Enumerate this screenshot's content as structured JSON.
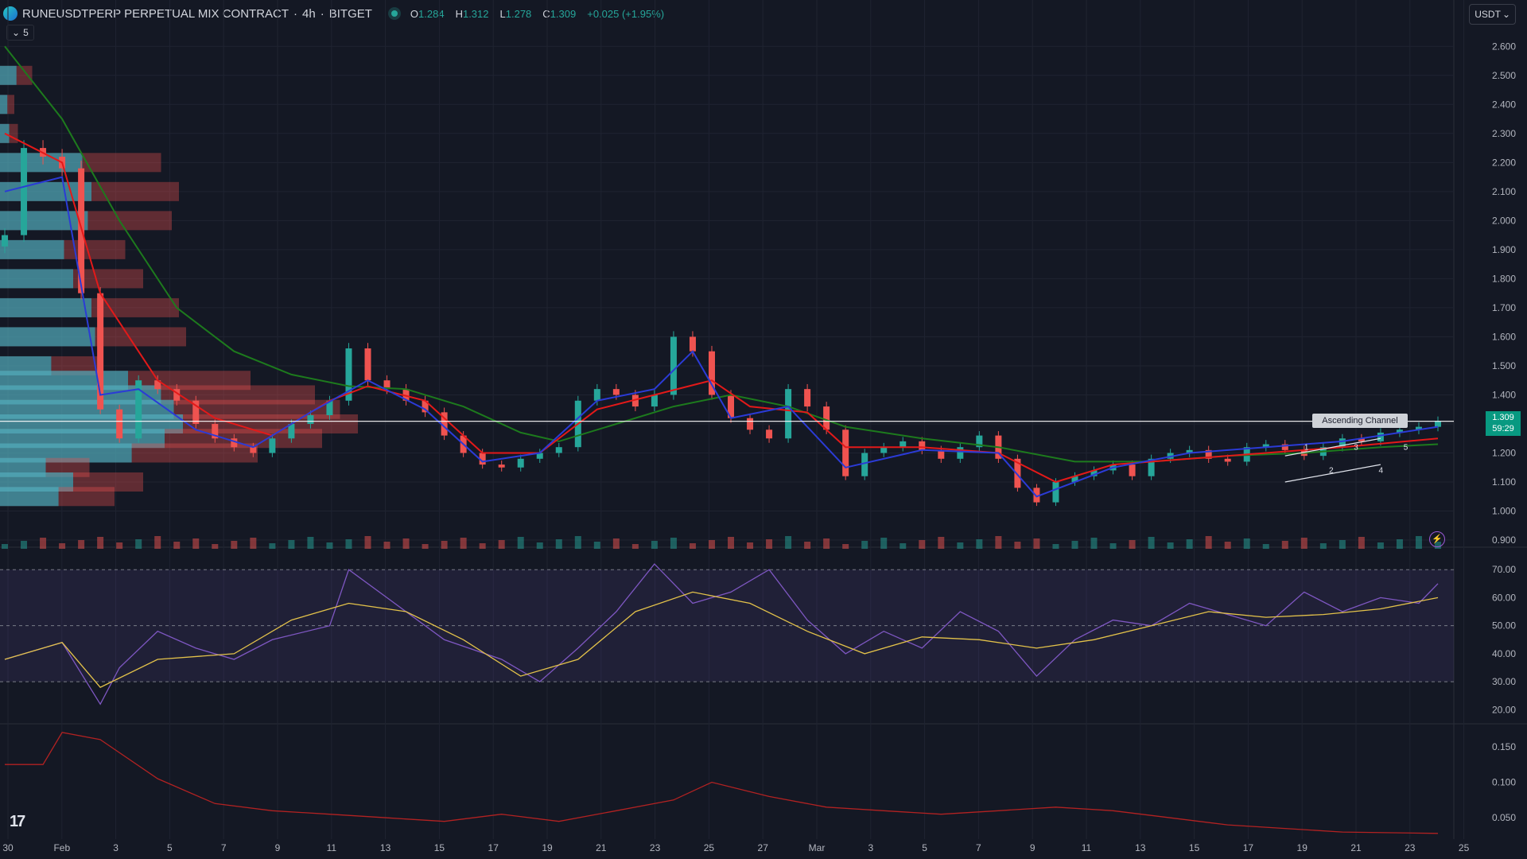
{
  "header": {
    "symbol": "RUNEUSDTPERP PERPETUAL MIX CONTRACT",
    "interval": "4h",
    "exchange": "BITGET",
    "sep": "·",
    "o_label": "O",
    "o": "1.284",
    "h_label": "H",
    "h": "1.312",
    "l_label": "L",
    "l": "1.278",
    "c_label": "C",
    "c": "1.309",
    "change": "+0.025 (+1.95%)",
    "indicator_count": "5",
    "currency": "USDT"
  },
  "current_price": {
    "value": "1.309",
    "countdown": "59:29"
  },
  "annotation": {
    "pattern_label": "Ascending Channel",
    "wave_labels": [
      "1",
      "2",
      "3",
      "4",
      "5"
    ]
  },
  "colors": {
    "bg": "#141824",
    "grid": "#1f2331",
    "up": "#26a69a",
    "down": "#ef5350",
    "ma_fast": "#2b3bd6",
    "ma_mid": "#e31919",
    "ma_slow": "#1d7a1d",
    "rsi": "#7e57c2",
    "rsi_ma": "#e3c24a",
    "lower": "#b22222"
  },
  "chart_data": [
    {
      "type": "candlestick",
      "title": "RUNEUSDTPERP PERPETUAL MIX CONTRACT · 4h · BITGET",
      "y_ticks": [
        "2.600",
        "2.500",
        "2.400",
        "2.300",
        "2.200",
        "2.100",
        "2.000",
        "1.900",
        "1.800",
        "1.700",
        "1.600",
        "1.500",
        "1.400",
        "1.300",
        "1.200",
        "1.100",
        "1.000",
        "0.900"
      ],
      "ylim": [
        0.87,
        2.65
      ],
      "x_ticks": [
        "30",
        "Feb",
        "3",
        "5",
        "7",
        "9",
        "11",
        "13",
        "15",
        "17",
        "19",
        "21",
        "23",
        "25",
        "27",
        "Mar",
        "3",
        "5",
        "7",
        "9",
        "11",
        "13",
        "15",
        "17",
        "19",
        "21",
        "23",
        "25"
      ],
      "close_path": [
        [
          0,
          1.95
        ],
        [
          1,
          2.25
        ],
        [
          2,
          2.22
        ],
        [
          3,
          2.18
        ],
        [
          4,
          1.75
        ],
        [
          5,
          1.35
        ],
        [
          6,
          1.25
        ],
        [
          7,
          1.45
        ],
        [
          8,
          1.42
        ],
        [
          9,
          1.38
        ],
        [
          10,
          1.3
        ],
        [
          11,
          1.25
        ],
        [
          12,
          1.22
        ],
        [
          13,
          1.2
        ],
        [
          14,
          1.25
        ],
        [
          15,
          1.3
        ],
        [
          16,
          1.33
        ],
        [
          17,
          1.38
        ],
        [
          18,
          1.56
        ],
        [
          19,
          1.45
        ],
        [
          20,
          1.42
        ],
        [
          21,
          1.38
        ],
        [
          22,
          1.34
        ],
        [
          23,
          1.26
        ],
        [
          24,
          1.2
        ],
        [
          25,
          1.16
        ],
        [
          26,
          1.15
        ],
        [
          27,
          1.18
        ],
        [
          28,
          1.2
        ],
        [
          29,
          1.22
        ],
        [
          30,
          1.38
        ],
        [
          31,
          1.42
        ],
        [
          32,
          1.4
        ],
        [
          33,
          1.36
        ],
        [
          34,
          1.4
        ],
        [
          35,
          1.6
        ],
        [
          36,
          1.55
        ],
        [
          37,
          1.4
        ],
        [
          38,
          1.32
        ],
        [
          39,
          1.28
        ],
        [
          40,
          1.25
        ],
        [
          41,
          1.42
        ],
        [
          42,
          1.36
        ],
        [
          43,
          1.28
        ],
        [
          44,
          1.12
        ],
        [
          45,
          1.2
        ],
        [
          46,
          1.22
        ],
        [
          47,
          1.24
        ],
        [
          48,
          1.21
        ],
        [
          49,
          1.18
        ],
        [
          50,
          1.22
        ],
        [
          51,
          1.26
        ],
        [
          52,
          1.18
        ],
        [
          53,
          1.08
        ],
        [
          54,
          1.03
        ],
        [
          55,
          1.1
        ],
        [
          56,
          1.12
        ],
        [
          57,
          1.14
        ],
        [
          58,
          1.16
        ],
        [
          59,
          1.12
        ],
        [
          60,
          1.18
        ],
        [
          61,
          1.2
        ],
        [
          62,
          1.21
        ],
        [
          63,
          1.18
        ],
        [
          64,
          1.17
        ],
        [
          65,
          1.22
        ],
        [
          66,
          1.23
        ],
        [
          67,
          1.21
        ],
        [
          68,
          1.19
        ],
        [
          69,
          1.22
        ],
        [
          70,
          1.25
        ],
        [
          71,
          1.24
        ],
        [
          72,
          1.27
        ],
        [
          73,
          1.28
        ],
        [
          74,
          1.29
        ],
        [
          75,
          1.31
        ]
      ],
      "ma_fast": [
        [
          0,
          2.1
        ],
        [
          3,
          2.15
        ],
        [
          5,
          1.4
        ],
        [
          7,
          1.42
        ],
        [
          10,
          1.28
        ],
        [
          13,
          1.22
        ],
        [
          16,
          1.34
        ],
        [
          19,
          1.45
        ],
        [
          22,
          1.35
        ],
        [
          25,
          1.17
        ],
        [
          28,
          1.2
        ],
        [
          31,
          1.38
        ],
        [
          34,
          1.42
        ],
        [
          36,
          1.55
        ],
        [
          38,
          1.32
        ],
        [
          41,
          1.36
        ],
        [
          44,
          1.15
        ],
        [
          48,
          1.21
        ],
        [
          52,
          1.2
        ],
        [
          54,
          1.05
        ],
        [
          58,
          1.15
        ],
        [
          62,
          1.2
        ],
        [
          66,
          1.22
        ],
        [
          70,
          1.24
        ],
        [
          75,
          1.29
        ]
      ],
      "ma_mid": [
        [
          0,
          2.3
        ],
        [
          3,
          2.2
        ],
        [
          5,
          1.75
        ],
        [
          8,
          1.45
        ],
        [
          11,
          1.32
        ],
        [
          14,
          1.26
        ],
        [
          17,
          1.38
        ],
        [
          19,
          1.43
        ],
        [
          22,
          1.38
        ],
        [
          25,
          1.2
        ],
        [
          28,
          1.2
        ],
        [
          31,
          1.35
        ],
        [
          34,
          1.4
        ],
        [
          37,
          1.45
        ],
        [
          39,
          1.36
        ],
        [
          42,
          1.34
        ],
        [
          44,
          1.22
        ],
        [
          48,
          1.22
        ],
        [
          52,
          1.2
        ],
        [
          55,
          1.1
        ],
        [
          58,
          1.16
        ],
        [
          62,
          1.18
        ],
        [
          66,
          1.2
        ],
        [
          70,
          1.22
        ],
        [
          75,
          1.25
        ]
      ],
      "ma_slow": [
        [
          0,
          2.6
        ],
        [
          3,
          2.35
        ],
        [
          6,
          2.0
        ],
        [
          9,
          1.7
        ],
        [
          12,
          1.55
        ],
        [
          15,
          1.47
        ],
        [
          18,
          1.43
        ],
        [
          21,
          1.42
        ],
        [
          24,
          1.36
        ],
        [
          27,
          1.27
        ],
        [
          29,
          1.24
        ],
        [
          32,
          1.3
        ],
        [
          35,
          1.36
        ],
        [
          38,
          1.4
        ],
        [
          41,
          1.36
        ],
        [
          44,
          1.29
        ],
        [
          48,
          1.25
        ],
        [
          52,
          1.22
        ],
        [
          56,
          1.17
        ],
        [
          60,
          1.17
        ],
        [
          64,
          1.19
        ],
        [
          68,
          1.2
        ],
        [
          72,
          1.22
        ],
        [
          75,
          1.23
        ]
      ],
      "volume_profile": [
        [
          2.5,
          0.09
        ],
        [
          2.4,
          0.04
        ],
        [
          2.3,
          0.05
        ],
        [
          2.2,
          0.45
        ],
        [
          2.1,
          0.5
        ],
        [
          2.0,
          0.48
        ],
        [
          1.9,
          0.35
        ],
        [
          1.8,
          0.4
        ],
        [
          1.7,
          0.5
        ],
        [
          1.6,
          0.52
        ],
        [
          1.5,
          0.28
        ],
        [
          1.45,
          0.7
        ],
        [
          1.4,
          0.88
        ],
        [
          1.35,
          0.95
        ],
        [
          1.3,
          1.0
        ],
        [
          1.25,
          0.9
        ],
        [
          1.2,
          0.72
        ],
        [
          1.15,
          0.25
        ],
        [
          1.1,
          0.4
        ],
        [
          1.05,
          0.32
        ]
      ]
    },
    {
      "type": "line",
      "title": "RSI",
      "y_ticks": [
        "70.00",
        "60.00",
        "50.00",
        "40.00",
        "30.00",
        "20.00"
      ],
      "ylim": [
        15,
        78
      ],
      "rsi": [
        [
          0,
          38
        ],
        [
          3,
          44
        ],
        [
          5,
          22
        ],
        [
          6,
          35
        ],
        [
          8,
          48
        ],
        [
          10,
          42
        ],
        [
          12,
          38
        ],
        [
          14,
          45
        ],
        [
          17,
          50
        ],
        [
          18,
          70
        ],
        [
          20,
          60
        ],
        [
          23,
          45
        ],
        [
          26,
          38
        ],
        [
          28,
          30
        ],
        [
          30,
          42
        ],
        [
          32,
          55
        ],
        [
          34,
          72
        ],
        [
          36,
          58
        ],
        [
          38,
          62
        ],
        [
          40,
          70
        ],
        [
          42,
          52
        ],
        [
          44,
          40
        ],
        [
          46,
          48
        ],
        [
          48,
          42
        ],
        [
          50,
          55
        ],
        [
          52,
          48
        ],
        [
          54,
          32
        ],
        [
          56,
          45
        ],
        [
          58,
          52
        ],
        [
          60,
          50
        ],
        [
          62,
          58
        ],
        [
          64,
          54
        ],
        [
          66,
          50
        ],
        [
          68,
          62
        ],
        [
          70,
          55
        ],
        [
          72,
          60
        ],
        [
          74,
          58
        ],
        [
          75,
          65
        ]
      ],
      "rsi_ma": [
        [
          0,
          38
        ],
        [
          3,
          44
        ],
        [
          5,
          28
        ],
        [
          8,
          38
        ],
        [
          12,
          40
        ],
        [
          15,
          52
        ],
        [
          18,
          58
        ],
        [
          21,
          55
        ],
        [
          24,
          45
        ],
        [
          27,
          32
        ],
        [
          30,
          38
        ],
        [
          33,
          55
        ],
        [
          36,
          62
        ],
        [
          39,
          58
        ],
        [
          42,
          48
        ],
        [
          45,
          40
        ],
        [
          48,
          46
        ],
        [
          51,
          45
        ],
        [
          54,
          42
        ],
        [
          57,
          45
        ],
        [
          60,
          50
        ],
        [
          63,
          55
        ],
        [
          66,
          53
        ],
        [
          69,
          54
        ],
        [
          72,
          56
        ],
        [
          75,
          60
        ]
      ]
    },
    {
      "type": "line",
      "title": "Volatility",
      "y_ticks": [
        "0.150",
        "0.100",
        "0.050"
      ],
      "ylim": [
        0.02,
        0.18
      ],
      "values": [
        [
          0,
          0.125
        ],
        [
          2,
          0.125
        ],
        [
          3,
          0.17
        ],
        [
          5,
          0.16
        ],
        [
          8,
          0.105
        ],
        [
          11,
          0.07
        ],
        [
          14,
          0.06
        ],
        [
          17,
          0.055
        ],
        [
          20,
          0.05
        ],
        [
          23,
          0.045
        ],
        [
          26,
          0.055
        ],
        [
          29,
          0.045
        ],
        [
          32,
          0.06
        ],
        [
          35,
          0.075
        ],
        [
          37,
          0.1
        ],
        [
          40,
          0.08
        ],
        [
          43,
          0.065
        ],
        [
          46,
          0.06
        ],
        [
          49,
          0.055
        ],
        [
          52,
          0.06
        ],
        [
          55,
          0.065
        ],
        [
          58,
          0.06
        ],
        [
          61,
          0.05
        ],
        [
          64,
          0.04
        ],
        [
          67,
          0.035
        ],
        [
          70,
          0.03
        ],
        [
          75,
          0.028
        ]
      ]
    }
  ]
}
